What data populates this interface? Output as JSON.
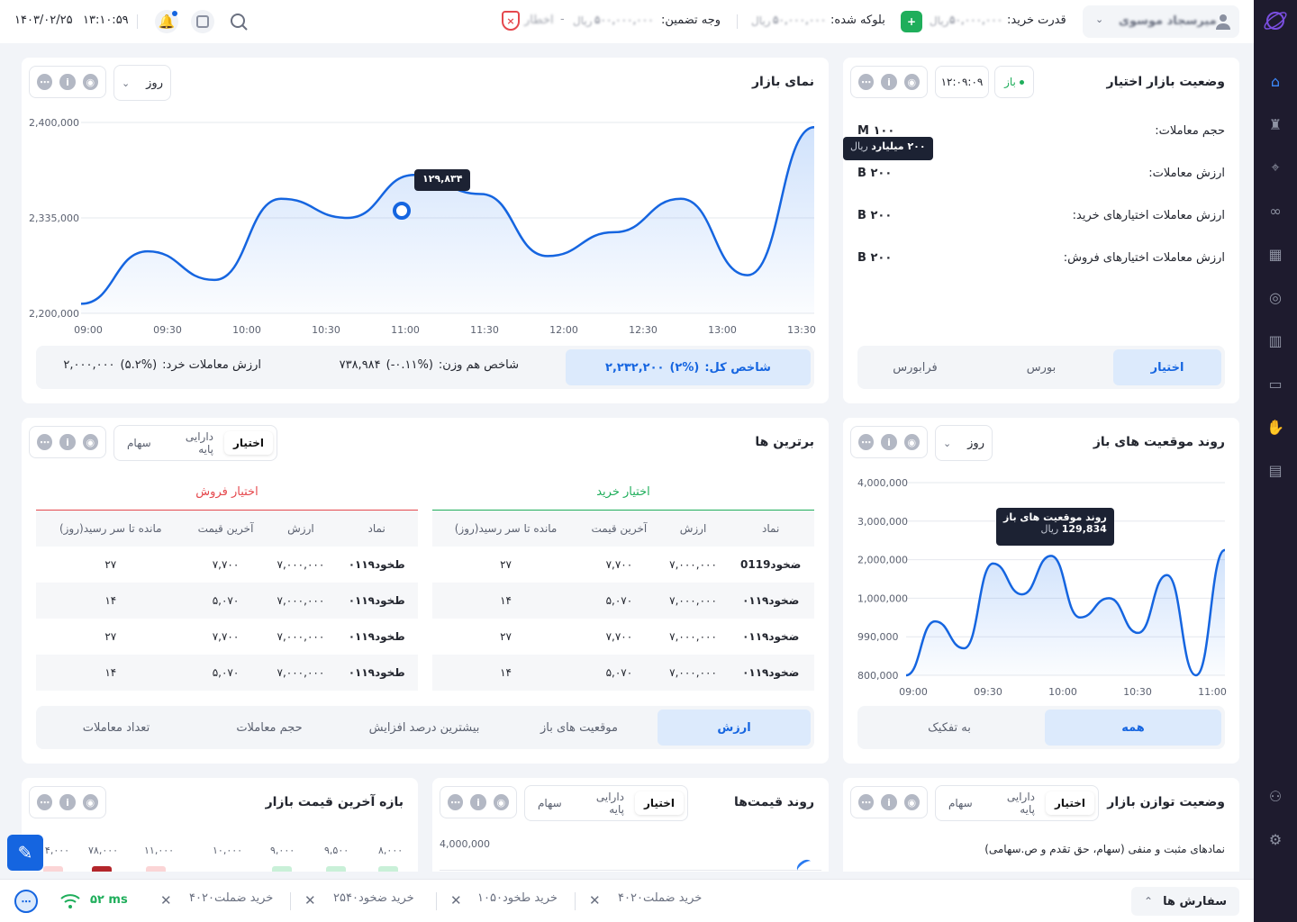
{
  "header": {
    "date": "۱۴۰۳/۰۲/۲۵",
    "time": "۱۳:۱۰:۵۹",
    "user_name": "میرسجاد موسوی",
    "buying_power_label": "قدرت خرید:",
    "buying_power_value": "۵۰,۰۰۰,۰۰۰",
    "blocked_label": "بلوکه شده:",
    "blocked_value": "۵۰,۰۰۰,۰۰۰",
    "collateral_label": "وجه تضمین:",
    "collateral_value": "۵۰۰,۰۰۰,۰۰۰",
    "currency": "ریال",
    "warning_label": "اخطار",
    "dash": "-"
  },
  "market_status": {
    "title": "وضعیت بازار اختیار",
    "status_text": "باز",
    "clock": "۱۲:۰۹:۰۹",
    "rows": [
      {
        "label": "حجم معاملات:",
        "value": "۱۰۰ M"
      },
      {
        "label": "ارزش معاملات:",
        "value": "۲۰۰ B"
      },
      {
        "label": "ارزش معاملات اختیارهای خرید:",
        "value": "۲۰۰ B"
      },
      {
        "label": "ارزش معاملات اختیارهای فروش:",
        "value": "۲۰۰ B"
      }
    ],
    "tooltip_amount": "۲۰۰ میلیارد",
    "tooltip_unit": "ریال",
    "tabs": [
      "اختیار",
      "بورس",
      "فرابورس"
    ],
    "active_tab": "اختیار"
  },
  "market_view": {
    "title": "نمای بازار",
    "period": "روز",
    "tooltip": "۱۲۹,۸۳۴",
    "total_index_label": "شاخص کل:",
    "total_index_value": "۲,۲۳۲,۲۰۰",
    "total_index_change": "(۲%)",
    "equal_weight_label": "شاخص هم وزن:",
    "equal_weight_value": "۷۳۸,۹۸۴",
    "equal_weight_change": "(۰.۱۱%-)",
    "retail_label": "ارزش معاملات خرد:",
    "retail_value": "۲,۰۰۰,۰۰۰",
    "retail_change": "(۵.۲%)"
  },
  "open_positions": {
    "title": "روند موقعیت های باز",
    "period": "روز",
    "tooltip_title": "روند موقعیت های باز",
    "tooltip_value": "129,834",
    "tooltip_unit": "ریال",
    "tabs": [
      "همه",
      "به تفکیک"
    ],
    "active_tab": "همه"
  },
  "top": {
    "title": "برترین ها",
    "asset_tabs": [
      "اختیار",
      "دارایی پایه",
      "سهام"
    ],
    "active_asset_tab": "اختیار",
    "buy_header": "اختیار خرید",
    "sell_header": "اختیار فروش",
    "columns": [
      "نماد",
      "ارزش",
      "آخرین قیمت",
      "مانده تا سر رسید(روز)"
    ],
    "buy_rows": [
      [
        "ضخود0119",
        "۷,۰۰۰,۰۰۰",
        "۷,۷۰۰",
        "۲۷"
      ],
      [
        "ضخود۰۱۱۹",
        "۷,۰۰۰,۰۰۰",
        "۵,۰۷۰",
        "۱۴"
      ],
      [
        "ضخود۰۱۱۹",
        "۷,۰۰۰,۰۰۰",
        "۷,۷۰۰",
        "۲۷"
      ],
      [
        "ضخود۰۱۱۹",
        "۷,۰۰۰,۰۰۰",
        "۵,۰۷۰",
        "۱۴"
      ]
    ],
    "sell_rows": [
      [
        "طخود۰۱۱۹",
        "۷,۰۰۰,۰۰۰",
        "۷,۷۰۰",
        "۲۷"
      ],
      [
        "طخود۰۱۱۹",
        "۷,۰۰۰,۰۰۰",
        "۵,۰۷۰",
        "۱۴"
      ],
      [
        "طخود۰۱۱۹",
        "۷,۰۰۰,۰۰۰",
        "۷,۷۰۰",
        "۲۷"
      ],
      [
        "طخود۰۱۱۹",
        "۷,۰۰۰,۰۰۰",
        "۵,۰۷۰",
        "۱۴"
      ]
    ],
    "metric_tabs": [
      "ارزش",
      "موقعیت های باز",
      "بیشترین درصد افزایش",
      "حجم معاملات",
      "تعداد معاملات"
    ],
    "active_metric_tab": "ارزش"
  },
  "balance": {
    "title": "وضعیت توازن بازار",
    "asset_tabs": [
      "اختیار",
      "دارایی پایه",
      "سهام"
    ],
    "subtitle": "نمادهای مثبت و منفی (سهام، حق تقدم و ص.سهامی)"
  },
  "price_trend": {
    "title": "روند قیمت‌ها",
    "asset_tabs": [
      "اختیار",
      "دارایی پایه",
      "سهام"
    ],
    "y_top_label": "4,000,000"
  },
  "price_range": {
    "title": "بازه آخرین قیمت بازار",
    "bucket_labels": [
      "۸,۰۰۰",
      "۹,۵۰۰",
      "۹,۰۰۰",
      "۱۰,۰۰۰",
      "۱۱,۰۰۰",
      "۷۸,۰۰۰",
      "۱۴,۰۰۰"
    ]
  },
  "footer": {
    "orders_label": "سفارش ها",
    "latency": "۵۲ ms",
    "tickers": [
      "خرید ضملت۴۰۲۰",
      "خرید طخود۱۰۵۰",
      "خرید ضخود۲۵۴۰",
      "خرید ضملت۴۰۲۰"
    ]
  },
  "chart_data": [
    {
      "type": "area",
      "title": "نمای بازار",
      "x": [
        "09:00",
        "09:30",
        "10:00",
        "10:30",
        "11:00",
        "11:30",
        "12:00",
        "12:30",
        "13:00",
        "13:30"
      ],
      "y_tick_labels": [
        "2,400,000",
        "2,335,000",
        "2,200,000"
      ],
      "series": [
        {
          "values": [
            2210000,
            2265000,
            2235000,
            2320000,
            2300000,
            2345000,
            2325000,
            2260000,
            2285000,
            2320000,
            2240000,
            2395000
          ]
        }
      ],
      "ylim": [
        2200000,
        2400000
      ],
      "grid": true
    },
    {
      "type": "area",
      "title": "روند موقعیت های باز",
      "x": [
        "09:00",
        "09:30",
        "10:00",
        "10:30",
        "11:00"
      ],
      "y_tick_labels": [
        "4,000,000",
        "3,000,000",
        "2,000,000",
        "1,000,000",
        "990,000",
        "800,000"
      ],
      "series": [
        {
          "values": [
            0.0,
            0.28,
            0.14,
            0.58,
            0.42,
            0.62,
            0.3,
            0.4,
            0.22,
            0.52,
            0.0,
            0.65
          ]
        }
      ],
      "grid": true
    }
  ],
  "colors": {
    "accent": "#1565e0",
    "buy": "#1fae5b",
    "sell": "#e5484d",
    "rail": "#1e1b2e"
  }
}
